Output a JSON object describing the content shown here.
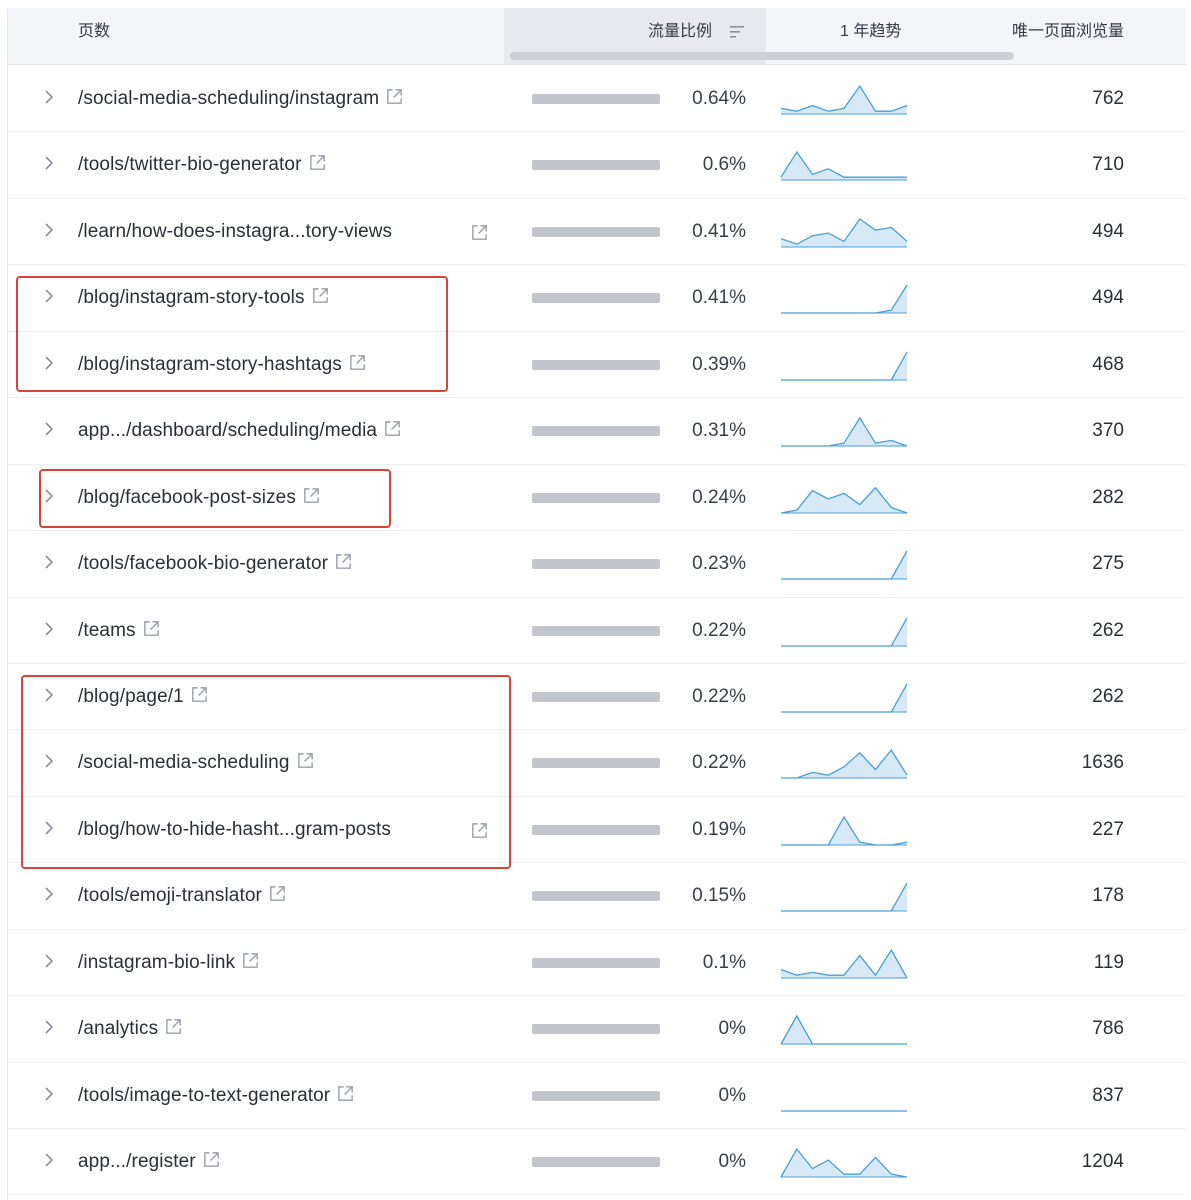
{
  "table": {
    "headers": {
      "pages": "页数",
      "traffic_share": "流量比例",
      "trend": "1 年趋势",
      "unique_pageviews": "唯一页面浏览量"
    },
    "sorted_column": "traffic_share",
    "sort_icon": "sort-descending-icon",
    "row_expand_icon": "chevron-right-icon",
    "external_link_icon": "external-link-icon",
    "trend_color": "#4a9fd8",
    "highlight_color": "#d9443a",
    "rows": [
      {
        "path": "/social-media-scheduling/instagram",
        "share": "0.64%",
        "views": "762",
        "trend": [
          2,
          1,
          3,
          1,
          2,
          10,
          1,
          1,
          3
        ]
      },
      {
        "path": "/tools/twitter-bio-generator",
        "share": "0.6%",
        "views": "710",
        "trend": [
          1,
          10,
          2,
          4,
          1,
          1,
          1,
          1,
          1
        ]
      },
      {
        "path": "/learn/how-does-instagra...tory-views",
        "share": "0.41%",
        "views": "494",
        "trend": [
          3,
          1,
          4,
          5,
          2,
          10,
          6,
          7,
          2
        ]
      },
      {
        "path": "/blog/instagram-story-tools",
        "share": "0.41%",
        "views": "494",
        "trend": [
          0,
          0,
          0,
          0,
          0,
          0,
          0,
          1,
          10
        ]
      },
      {
        "path": "/blog/instagram-story-hashtags",
        "share": "0.39%",
        "views": "468",
        "trend": [
          0,
          0,
          0,
          0,
          0,
          0,
          0,
          0,
          10
        ]
      },
      {
        "path": "app.../dashboard/scheduling/media",
        "share": "0.31%",
        "views": "370",
        "trend": [
          0,
          0,
          0,
          0,
          1,
          10,
          1,
          2,
          0
        ]
      },
      {
        "path": "/blog/facebook-post-sizes",
        "share": "0.24%",
        "views": "282",
        "trend": [
          0,
          1,
          8,
          5,
          7,
          3,
          9,
          2,
          0
        ]
      },
      {
        "path": "/tools/facebook-bio-generator",
        "share": "0.23%",
        "views": "275",
        "trend": [
          0,
          0,
          0,
          0,
          0,
          0,
          0,
          0,
          10
        ]
      },
      {
        "path": "/teams",
        "share": "0.22%",
        "views": "262",
        "trend": [
          0,
          0,
          0,
          0,
          0,
          0,
          0,
          0,
          10
        ]
      },
      {
        "path": "/blog/page/1",
        "share": "0.22%",
        "views": "262",
        "trend": [
          0,
          0,
          0,
          0,
          0,
          0,
          0,
          0,
          10
        ]
      },
      {
        "path": "/social-media-scheduling",
        "share": "0.22%",
        "views": "1636",
        "trend": [
          0,
          0,
          2,
          1,
          4,
          9,
          3,
          10,
          1
        ]
      },
      {
        "path": "/blog/how-to-hide-hasht...gram-posts",
        "share": "0.19%",
        "views": "227",
        "trend": [
          0,
          0,
          0,
          0,
          10,
          1,
          0,
          0,
          1
        ]
      },
      {
        "path": "/tools/emoji-translator",
        "share": "0.15%",
        "views": "178",
        "trend": [
          0,
          0,
          0,
          0,
          0,
          0,
          0,
          0,
          10
        ]
      },
      {
        "path": "/instagram-bio-link",
        "share": "0.1%",
        "views": "119",
        "trend": [
          3,
          1,
          2,
          1,
          1,
          8,
          1,
          10,
          0
        ]
      },
      {
        "path": "/analytics",
        "share": "0%",
        "views": "786",
        "trend": [
          0,
          10,
          0,
          0,
          0,
          0,
          0,
          0,
          0
        ]
      },
      {
        "path": "/tools/image-to-text-generator",
        "share": "0%",
        "views": "837",
        "trend": [
          0,
          0,
          0,
          0,
          0,
          0,
          0,
          0,
          0
        ]
      },
      {
        "path": "app.../register",
        "share": "0%",
        "views": "1204",
        "trend": [
          0,
          10,
          3,
          6,
          1,
          1,
          7,
          1,
          0
        ]
      }
    ]
  }
}
